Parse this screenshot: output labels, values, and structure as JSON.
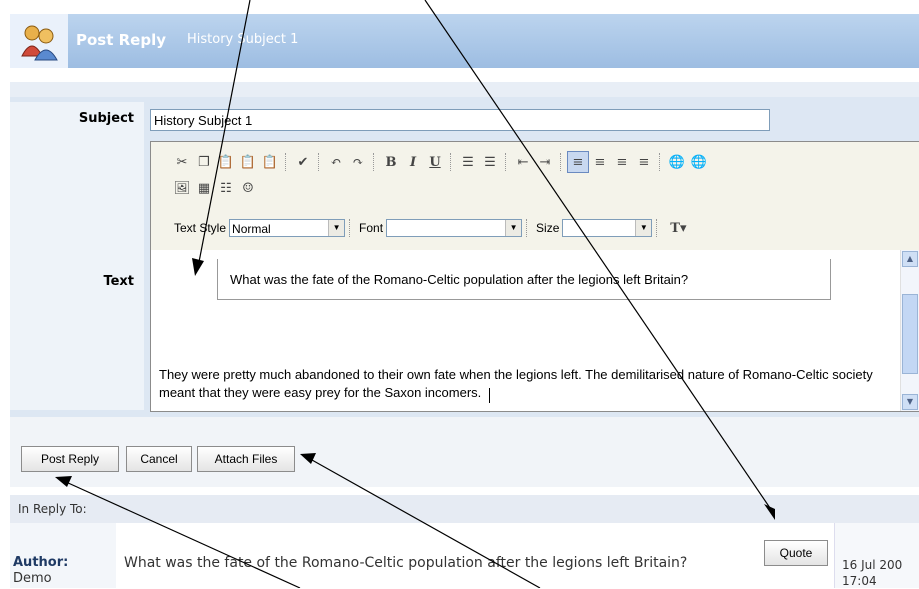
{
  "header": {
    "title": "Post Reply",
    "subject": "History Subject 1"
  },
  "form": {
    "subject_label": "Subject",
    "subject_value": "History Subject 1",
    "text_label": "Text",
    "toolbar": {
      "text_style_label": "Text Style",
      "text_style_value": "Normal",
      "font_label": "Font",
      "font_value": "",
      "size_label": "Size",
      "size_value": ""
    },
    "quoted_text": "What was the fate of the Romano-Celtic population after the legions left Britain?",
    "reply_text": "They were pretty much abandoned to their own fate when the legions left. The demilitarised nature of Romano-Celtic society meant that they were easy prey for the Saxon incomers."
  },
  "buttons": {
    "post_reply": "Post Reply",
    "cancel": "Cancel",
    "attach_files": "Attach Files",
    "quote": "Quote"
  },
  "in_reply": {
    "label": "In Reply To:",
    "author_label": "Author:",
    "author_name": "Demo",
    "post_text": "What was the fate of the Romano-Celtic population after the legions left Britain?",
    "date": "16 Jul 200",
    "time": "17:04"
  },
  "colors": {
    "header": "#9dbde2",
    "form_bg": "#dde7f3",
    "toolbar_bg": "#f4f3ea"
  }
}
